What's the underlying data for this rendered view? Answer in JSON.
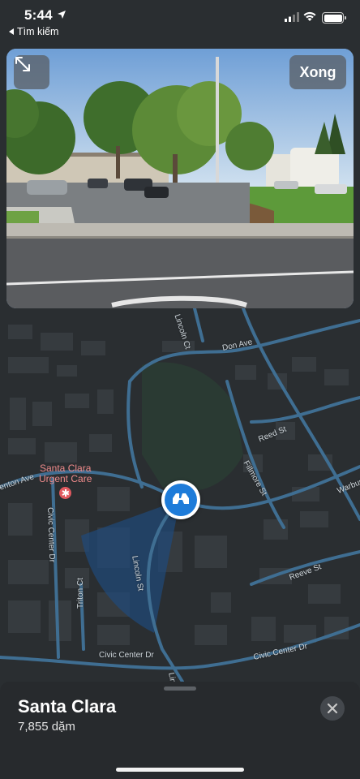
{
  "status_bar": {
    "time": "5:44",
    "back_app": "Tìm kiếm"
  },
  "look_around": {
    "done_label": "Xong",
    "expand_icon": "expand-arrows-icon"
  },
  "map": {
    "streets": [
      {
        "name": "Lincoln Ct"
      },
      {
        "name": "Don Ave"
      },
      {
        "name": "Reed St"
      },
      {
        "name": "Fillmore St"
      },
      {
        "name": "Warburton Ave"
      },
      {
        "name": "Lincoln St"
      },
      {
        "name": "Reeve St"
      },
      {
        "name": "Civic Center Dr"
      },
      {
        "name": "Triton Ct"
      },
      {
        "name": "Civic Center Dr"
      },
      {
        "name": "Civic Center Dr"
      },
      {
        "name": "Lincoln St"
      },
      {
        "name": "Benton Ave"
      }
    ],
    "poi": {
      "name_line1": "Santa Clara",
      "name_line2": "Urgent Care",
      "icon": "medical-icon",
      "color": "#e0595f"
    },
    "look_around_marker_icon": "binoculars-icon",
    "accent": "#1d7bd9"
  },
  "sheet": {
    "title": "Santa Clara",
    "distance": "7,855 dặm",
    "close_icon": "close-icon"
  }
}
